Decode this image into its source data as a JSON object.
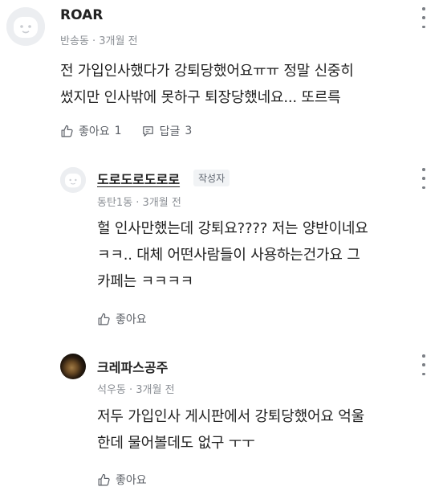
{
  "comments": [
    {
      "author": "ROAR",
      "meta": "반송동 · 3개월 전",
      "body": "전 가입인사했다가 강퇴당했어요ㅠㅠ 정말 신중히\n썼지만 인사밖에 못하구 퇴장당했네요... 또르륵",
      "like_label": "좋아요",
      "like_count": "1",
      "reply_label": "답글",
      "reply_count": "3",
      "avatar_icon": "default-avatar-icon"
    },
    {
      "author": "도로도로도로로",
      "badge": "작성자",
      "meta": "동탄1동 · 3개월 전",
      "body": "헐 인사만했는데 강퇴요???? 저는 양반이네요\nㅋㅋ.. 대체 어떤사람들이 사용하는건가요 그\n카페는 ㅋㅋㅋㅋ",
      "like_label": "좋아요",
      "avatar_icon": "default-avatar-icon"
    },
    {
      "author": "크레파스공주",
      "meta": "석우동 · 3개월 전",
      "body": "저두 가입인사 게시판에서 강퇴당했어요 억울\n한데 물어볼데도 없구 ㅜㅜ",
      "like_label": "좋아요",
      "avatar_icon": "photo-avatar"
    }
  ],
  "colors": {
    "text": "#1f1f1f",
    "meta": "#8b8f95",
    "action": "#5b5f66",
    "badge_bg": "#f1f3f5"
  },
  "icons": [
    "thumbs-up-icon",
    "reply-icon",
    "more-vertical-icon"
  ]
}
